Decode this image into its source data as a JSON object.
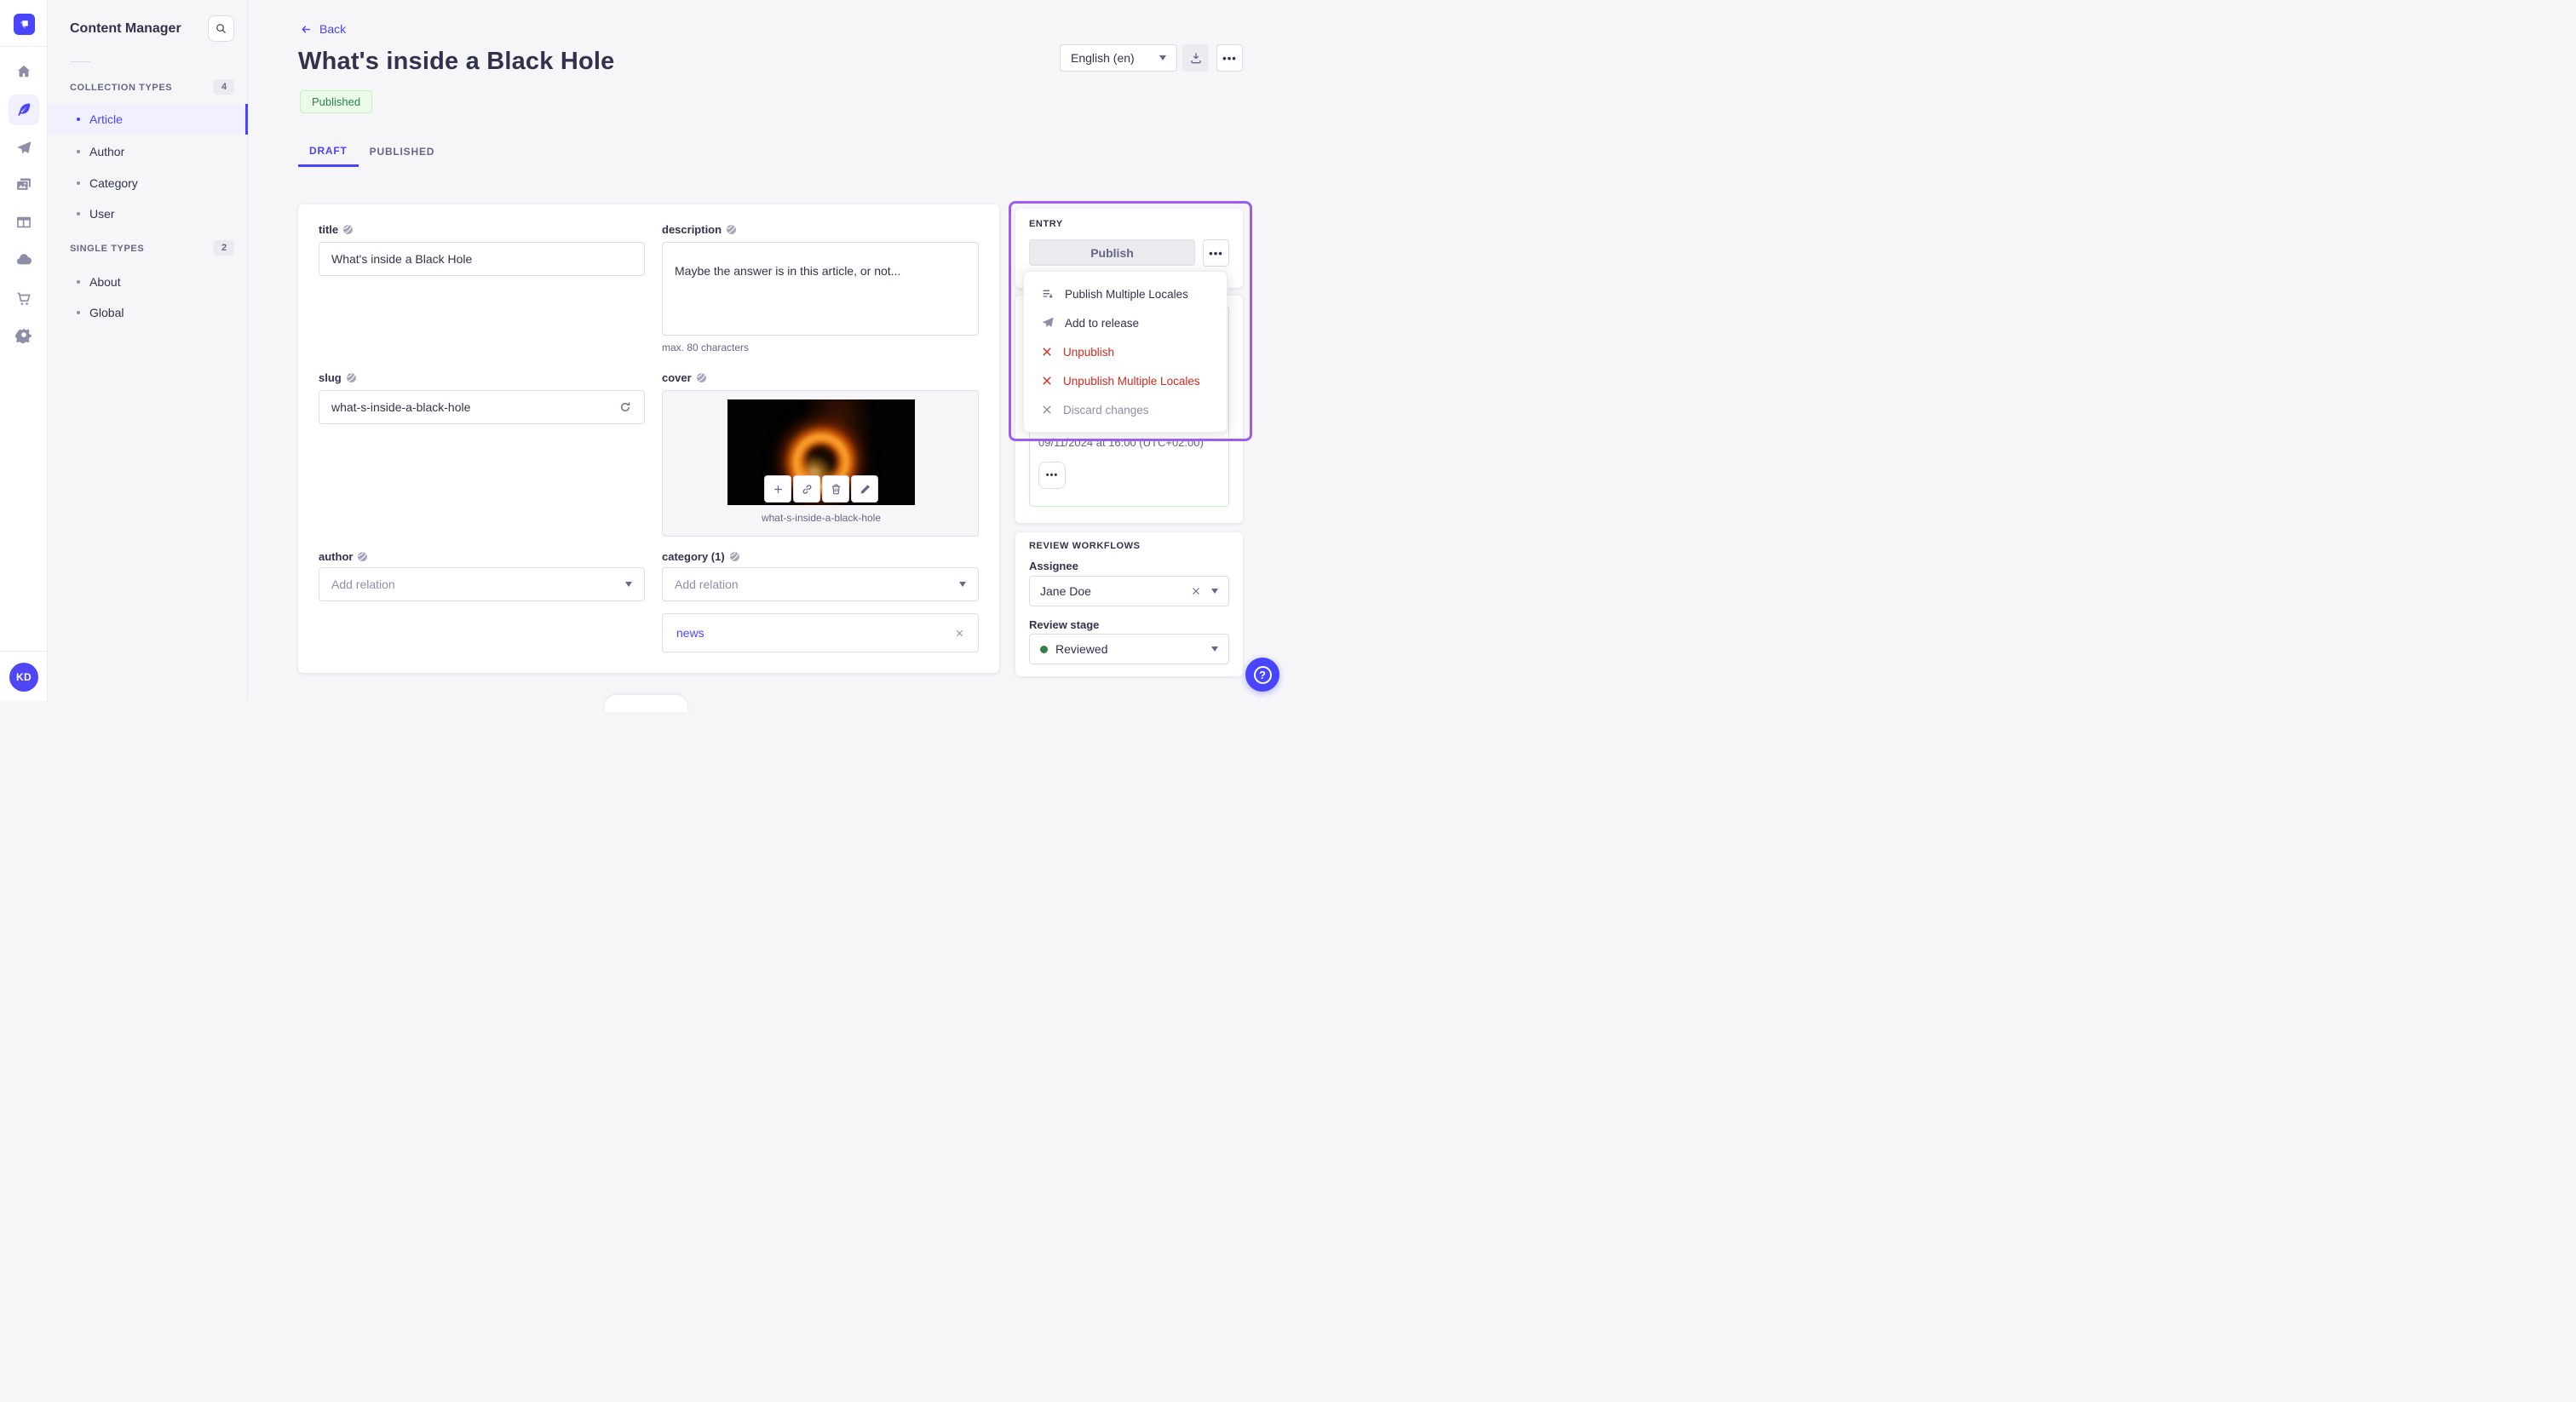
{
  "colors": {
    "primary": "#4945ff",
    "primary_light_bg": "#f0f0ff",
    "danger": "#d02b20",
    "success_text": "#328048",
    "success_bg": "#eafbe7",
    "success_border": "#c6f0c2",
    "highlight_outline": "#9b5df2",
    "page_bg": "#f6f6f9"
  },
  "rail": {
    "avatar_initials": "KD"
  },
  "sidebar": {
    "title": "Content Manager",
    "sections": [
      {
        "label": "COLLECTION TYPES",
        "count": "4",
        "items": [
          {
            "label": "Article"
          },
          {
            "label": "Author"
          },
          {
            "label": "Category"
          },
          {
            "label": "User"
          }
        ]
      },
      {
        "label": "SINGLE TYPES",
        "count": "2",
        "items": [
          {
            "label": "About"
          },
          {
            "label": "Global"
          }
        ]
      }
    ]
  },
  "header": {
    "back_label": "Back",
    "title": "What's inside a Black Hole",
    "status_badge": "Published",
    "tabs": [
      {
        "label": "DRAFT"
      },
      {
        "label": "PUBLISHED"
      }
    ],
    "locale_select": "English (en)"
  },
  "form": {
    "title": {
      "label": "title",
      "value": "What's inside a Black Hole"
    },
    "description": {
      "label": "description",
      "value": "Maybe the answer is in this article, or not...",
      "hint": "max. 80 characters"
    },
    "slug": {
      "label": "slug",
      "value": "what-s-inside-a-black-hole"
    },
    "cover": {
      "label": "cover",
      "caption": "what-s-inside-a-black-hole"
    },
    "author": {
      "label": "author",
      "placeholder": "Add relation"
    },
    "category": {
      "label": "category (1)",
      "placeholder": "Add relation",
      "relation": "news"
    }
  },
  "entry": {
    "heading": "ENTRY",
    "publish_label": "Publish",
    "menu": [
      {
        "label": "Publish Multiple Locales"
      },
      {
        "label": "Add to release"
      },
      {
        "label": "Unpublish"
      },
      {
        "label": "Unpublish Multiple Locales"
      },
      {
        "label": "Discard changes"
      }
    ],
    "scheduled": "09/11/2024 at 16:00 (UTC+02:00)"
  },
  "review": {
    "heading": "REVIEW WORKFLOWS",
    "assignee_label": "Assignee",
    "assignee_value": "Jane Doe",
    "stage_label": "Review stage",
    "stage_value": "Reviewed"
  }
}
